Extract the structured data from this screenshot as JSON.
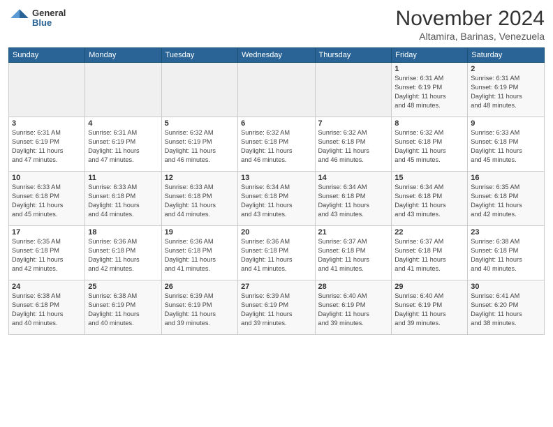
{
  "header": {
    "logo_general": "General",
    "logo_blue": "Blue",
    "month_title": "November 2024",
    "location": "Altamira, Barinas, Venezuela"
  },
  "weekdays": [
    "Sunday",
    "Monday",
    "Tuesday",
    "Wednesday",
    "Thursday",
    "Friday",
    "Saturday"
  ],
  "weeks": [
    [
      {
        "day": "",
        "info": ""
      },
      {
        "day": "",
        "info": ""
      },
      {
        "day": "",
        "info": ""
      },
      {
        "day": "",
        "info": ""
      },
      {
        "day": "",
        "info": ""
      },
      {
        "day": "1",
        "info": "Sunrise: 6:31 AM\nSunset: 6:19 PM\nDaylight: 11 hours\nand 48 minutes."
      },
      {
        "day": "2",
        "info": "Sunrise: 6:31 AM\nSunset: 6:19 PM\nDaylight: 11 hours\nand 48 minutes."
      }
    ],
    [
      {
        "day": "3",
        "info": "Sunrise: 6:31 AM\nSunset: 6:19 PM\nDaylight: 11 hours\nand 47 minutes."
      },
      {
        "day": "4",
        "info": "Sunrise: 6:31 AM\nSunset: 6:19 PM\nDaylight: 11 hours\nand 47 minutes."
      },
      {
        "day": "5",
        "info": "Sunrise: 6:32 AM\nSunset: 6:19 PM\nDaylight: 11 hours\nand 46 minutes."
      },
      {
        "day": "6",
        "info": "Sunrise: 6:32 AM\nSunset: 6:18 PM\nDaylight: 11 hours\nand 46 minutes."
      },
      {
        "day": "7",
        "info": "Sunrise: 6:32 AM\nSunset: 6:18 PM\nDaylight: 11 hours\nand 46 minutes."
      },
      {
        "day": "8",
        "info": "Sunrise: 6:32 AM\nSunset: 6:18 PM\nDaylight: 11 hours\nand 45 minutes."
      },
      {
        "day": "9",
        "info": "Sunrise: 6:33 AM\nSunset: 6:18 PM\nDaylight: 11 hours\nand 45 minutes."
      }
    ],
    [
      {
        "day": "10",
        "info": "Sunrise: 6:33 AM\nSunset: 6:18 PM\nDaylight: 11 hours\nand 45 minutes."
      },
      {
        "day": "11",
        "info": "Sunrise: 6:33 AM\nSunset: 6:18 PM\nDaylight: 11 hours\nand 44 minutes."
      },
      {
        "day": "12",
        "info": "Sunrise: 6:33 AM\nSunset: 6:18 PM\nDaylight: 11 hours\nand 44 minutes."
      },
      {
        "day": "13",
        "info": "Sunrise: 6:34 AM\nSunset: 6:18 PM\nDaylight: 11 hours\nand 43 minutes."
      },
      {
        "day": "14",
        "info": "Sunrise: 6:34 AM\nSunset: 6:18 PM\nDaylight: 11 hours\nand 43 minutes."
      },
      {
        "day": "15",
        "info": "Sunrise: 6:34 AM\nSunset: 6:18 PM\nDaylight: 11 hours\nand 43 minutes."
      },
      {
        "day": "16",
        "info": "Sunrise: 6:35 AM\nSunset: 6:18 PM\nDaylight: 11 hours\nand 42 minutes."
      }
    ],
    [
      {
        "day": "17",
        "info": "Sunrise: 6:35 AM\nSunset: 6:18 PM\nDaylight: 11 hours\nand 42 minutes."
      },
      {
        "day": "18",
        "info": "Sunrise: 6:36 AM\nSunset: 6:18 PM\nDaylight: 11 hours\nand 42 minutes."
      },
      {
        "day": "19",
        "info": "Sunrise: 6:36 AM\nSunset: 6:18 PM\nDaylight: 11 hours\nand 41 minutes."
      },
      {
        "day": "20",
        "info": "Sunrise: 6:36 AM\nSunset: 6:18 PM\nDaylight: 11 hours\nand 41 minutes."
      },
      {
        "day": "21",
        "info": "Sunrise: 6:37 AM\nSunset: 6:18 PM\nDaylight: 11 hours\nand 41 minutes."
      },
      {
        "day": "22",
        "info": "Sunrise: 6:37 AM\nSunset: 6:18 PM\nDaylight: 11 hours\nand 41 minutes."
      },
      {
        "day": "23",
        "info": "Sunrise: 6:38 AM\nSunset: 6:18 PM\nDaylight: 11 hours\nand 40 minutes."
      }
    ],
    [
      {
        "day": "24",
        "info": "Sunrise: 6:38 AM\nSunset: 6:18 PM\nDaylight: 11 hours\nand 40 minutes."
      },
      {
        "day": "25",
        "info": "Sunrise: 6:38 AM\nSunset: 6:19 PM\nDaylight: 11 hours\nand 40 minutes."
      },
      {
        "day": "26",
        "info": "Sunrise: 6:39 AM\nSunset: 6:19 PM\nDaylight: 11 hours\nand 39 minutes."
      },
      {
        "day": "27",
        "info": "Sunrise: 6:39 AM\nSunset: 6:19 PM\nDaylight: 11 hours\nand 39 minutes."
      },
      {
        "day": "28",
        "info": "Sunrise: 6:40 AM\nSunset: 6:19 PM\nDaylight: 11 hours\nand 39 minutes."
      },
      {
        "day": "29",
        "info": "Sunrise: 6:40 AM\nSunset: 6:19 PM\nDaylight: 11 hours\nand 39 minutes."
      },
      {
        "day": "30",
        "info": "Sunrise: 6:41 AM\nSunset: 6:20 PM\nDaylight: 11 hours\nand 38 minutes."
      }
    ]
  ]
}
